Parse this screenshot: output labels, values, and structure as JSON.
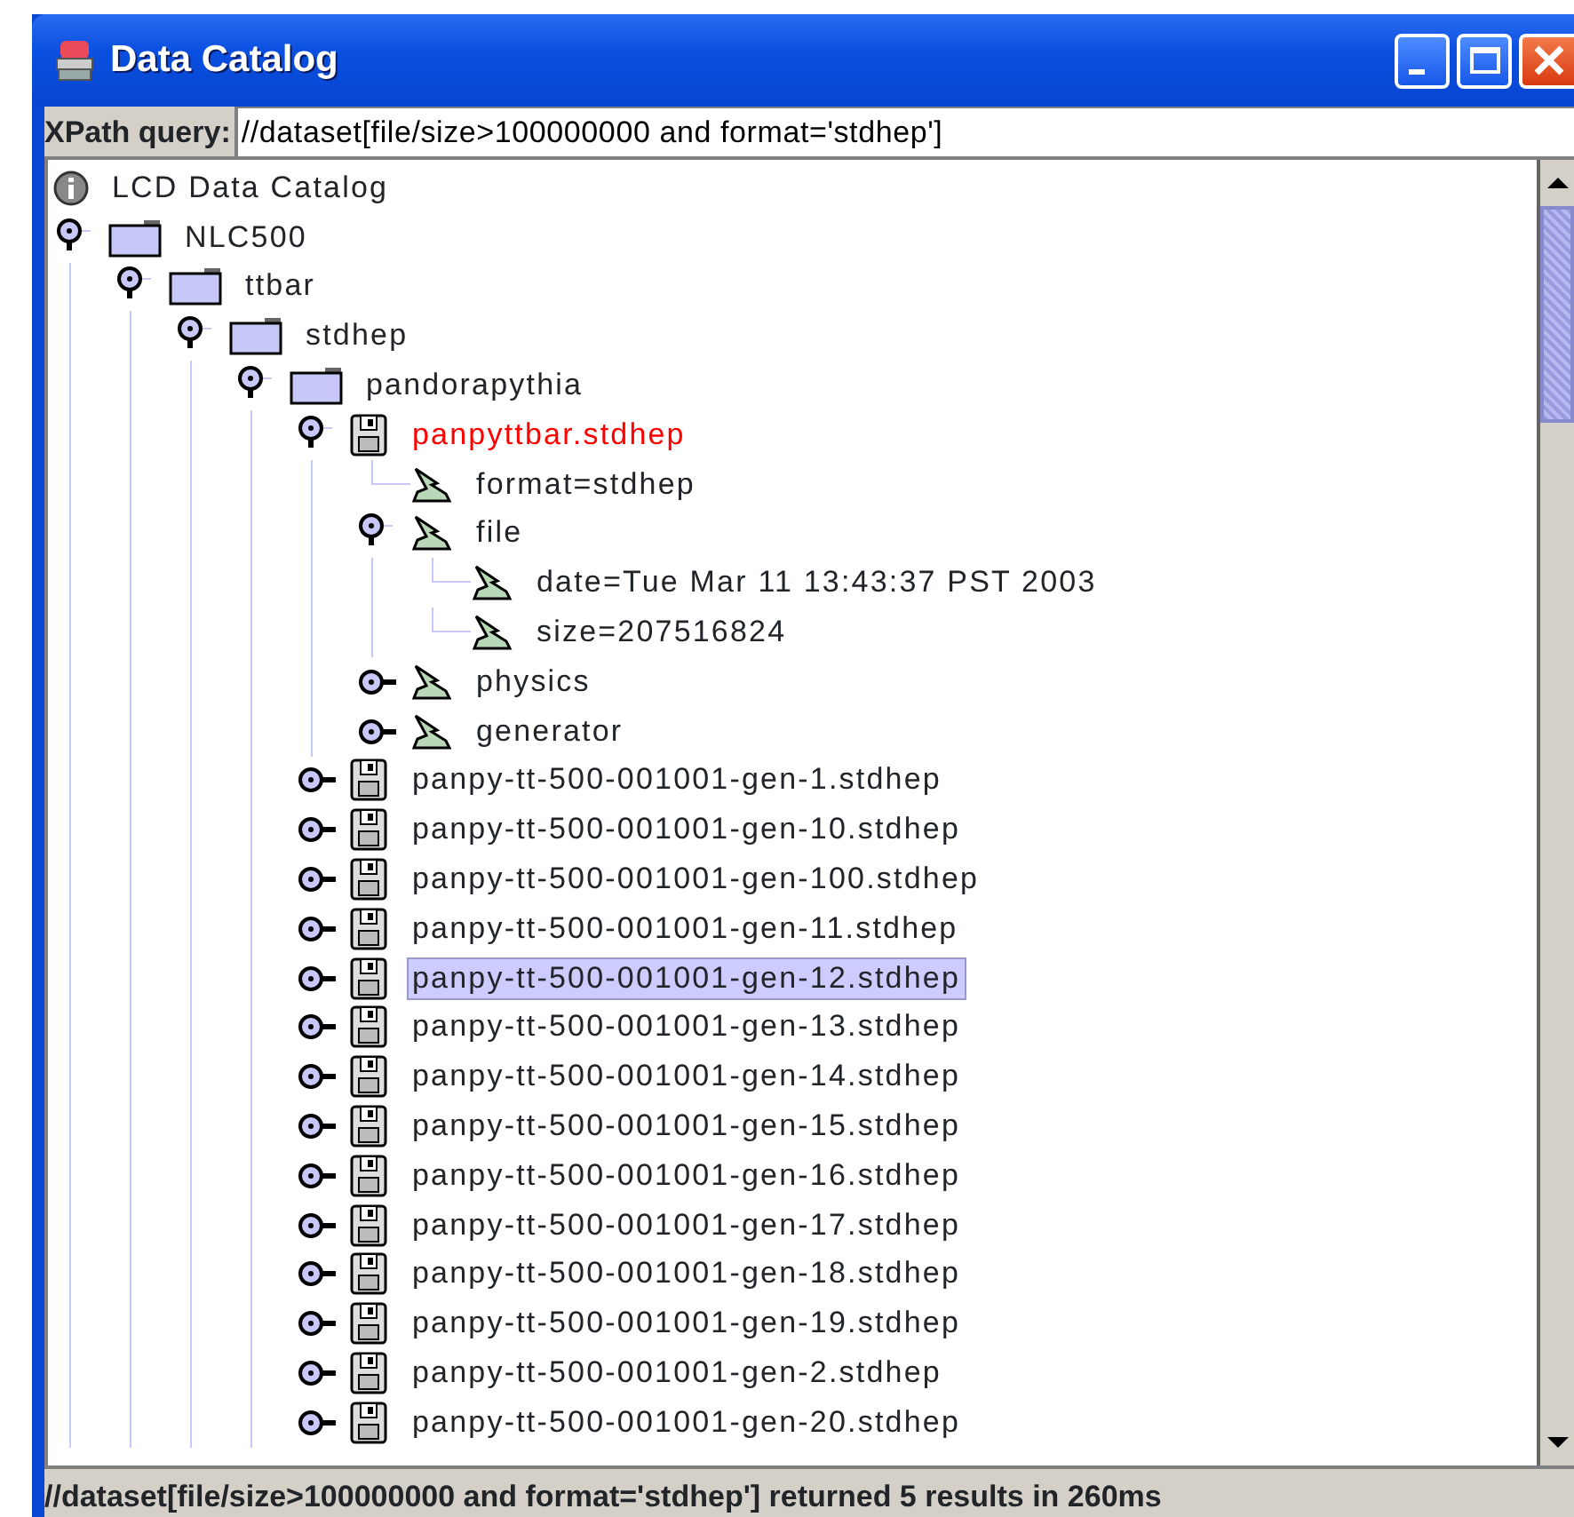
{
  "window": {
    "title": "Data Catalog"
  },
  "query": {
    "label": "XPath query:",
    "value": "//dataset[file/size>100000000 and format='stdhep']"
  },
  "tree": {
    "label": "LCD Data Catalog",
    "kind": "root",
    "selected": false,
    "matched": false,
    "children": [
      {
        "label": "NLC500",
        "kind": "folder",
        "expanded": true,
        "selected": false,
        "matched": false,
        "children": [
          {
            "label": "ttbar",
            "kind": "folder",
            "expanded": true,
            "selected": false,
            "matched": false,
            "children": [
              {
                "label": "stdhep",
                "kind": "folder",
                "expanded": true,
                "selected": false,
                "matched": false,
                "children": [
                  {
                    "label": "pandorapythia",
                    "kind": "folder",
                    "expanded": true,
                    "selected": false,
                    "matched": false,
                    "children": [
                      {
                        "label": "panpyttbar.stdhep",
                        "kind": "dataset",
                        "expanded": true,
                        "selected": false,
                        "matched": true,
                        "children": [
                          {
                            "label": "format=stdhep",
                            "kind": "attribute",
                            "selected": false,
                            "matched": false
                          },
                          {
                            "label": "file",
                            "kind": "attribute",
                            "expanded": true,
                            "selected": false,
                            "matched": false,
                            "children": [
                              {
                                "label": "date=Tue Mar 11 13:43:37 PST 2003",
                                "kind": "attribute",
                                "selected": false,
                                "matched": false
                              },
                              {
                                "label": "size=207516824",
                                "kind": "attribute",
                                "selected": false,
                                "matched": false
                              }
                            ]
                          },
                          {
                            "label": "physics",
                            "kind": "attribute",
                            "expanded": false,
                            "selected": false,
                            "matched": false
                          },
                          {
                            "label": "generator",
                            "kind": "attribute",
                            "expanded": false,
                            "selected": false,
                            "matched": false
                          }
                        ]
                      },
                      {
                        "label": "panpy-tt-500-001001-gen-1.stdhep",
                        "kind": "dataset",
                        "expanded": false,
                        "selected": false,
                        "matched": false
                      },
                      {
                        "label": "panpy-tt-500-001001-gen-10.stdhep",
                        "kind": "dataset",
                        "expanded": false,
                        "selected": false,
                        "matched": false
                      },
                      {
                        "label": "panpy-tt-500-001001-gen-100.stdhep",
                        "kind": "dataset",
                        "expanded": false,
                        "selected": false,
                        "matched": false
                      },
                      {
                        "label": "panpy-tt-500-001001-gen-11.stdhep",
                        "kind": "dataset",
                        "expanded": false,
                        "selected": false,
                        "matched": false
                      },
                      {
                        "label": "panpy-tt-500-001001-gen-12.stdhep",
                        "kind": "dataset",
                        "expanded": false,
                        "selected": true,
                        "matched": false
                      },
                      {
                        "label": "panpy-tt-500-001001-gen-13.stdhep",
                        "kind": "dataset",
                        "expanded": false,
                        "selected": false,
                        "matched": false
                      },
                      {
                        "label": "panpy-tt-500-001001-gen-14.stdhep",
                        "kind": "dataset",
                        "expanded": false,
                        "selected": false,
                        "matched": false
                      },
                      {
                        "label": "panpy-tt-500-001001-gen-15.stdhep",
                        "kind": "dataset",
                        "expanded": false,
                        "selected": false,
                        "matched": false
                      },
                      {
                        "label": "panpy-tt-500-001001-gen-16.stdhep",
                        "kind": "dataset",
                        "expanded": false,
                        "selected": false,
                        "matched": false
                      },
                      {
                        "label": "panpy-tt-500-001001-gen-17.stdhep",
                        "kind": "dataset",
                        "expanded": false,
                        "selected": false,
                        "matched": false
                      },
                      {
                        "label": "panpy-tt-500-001001-gen-18.stdhep",
                        "kind": "dataset",
                        "expanded": false,
                        "selected": false,
                        "matched": false
                      },
                      {
                        "label": "panpy-tt-500-001001-gen-19.stdhep",
                        "kind": "dataset",
                        "expanded": false,
                        "selected": false,
                        "matched": false
                      },
                      {
                        "label": "panpy-tt-500-001001-gen-2.stdhep",
                        "kind": "dataset",
                        "expanded": false,
                        "selected": false,
                        "matched": false
                      },
                      {
                        "label": "panpy-tt-500-001001-gen-20.stdhep",
                        "kind": "dataset",
                        "expanded": false,
                        "selected": false,
                        "matched": false
                      }
                    ]
                  }
                ]
              }
            ]
          }
        ]
      }
    ]
  },
  "status_bar": "//dataset[file/size>100000000 and format='stdhep'] returned 5 results in 260ms"
}
